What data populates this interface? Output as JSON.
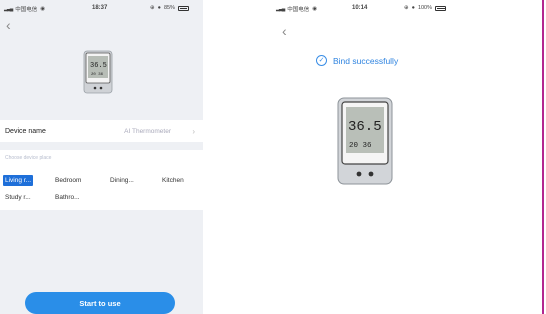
{
  "left_screen": {
    "status": {
      "carrier": "中国电信",
      "time": "18:37",
      "battery": "85%"
    },
    "device_name_label": "Device name",
    "device_name_value": "AI Thermometer",
    "place_title": "Choose device place",
    "places": [
      "Living r...",
      "Bedroom",
      "Dining...",
      "Kitchen",
      "Study r...",
      "Bathro..."
    ],
    "selected_place": "Living r...",
    "start_button": "Start to use",
    "device_display": {
      "temp": "36.5",
      "secondary": "20 36"
    }
  },
  "right_screen": {
    "status": {
      "carrier": "中国电信",
      "time": "10:14",
      "battery": "100%"
    },
    "bind_message": "Bind successfully",
    "device_display": {
      "temp": "36.5",
      "secondary": "20 36"
    }
  },
  "colors": {
    "accent": "#2a8ee8",
    "selected": "#1e6fd9",
    "frame": "#b3278f"
  }
}
